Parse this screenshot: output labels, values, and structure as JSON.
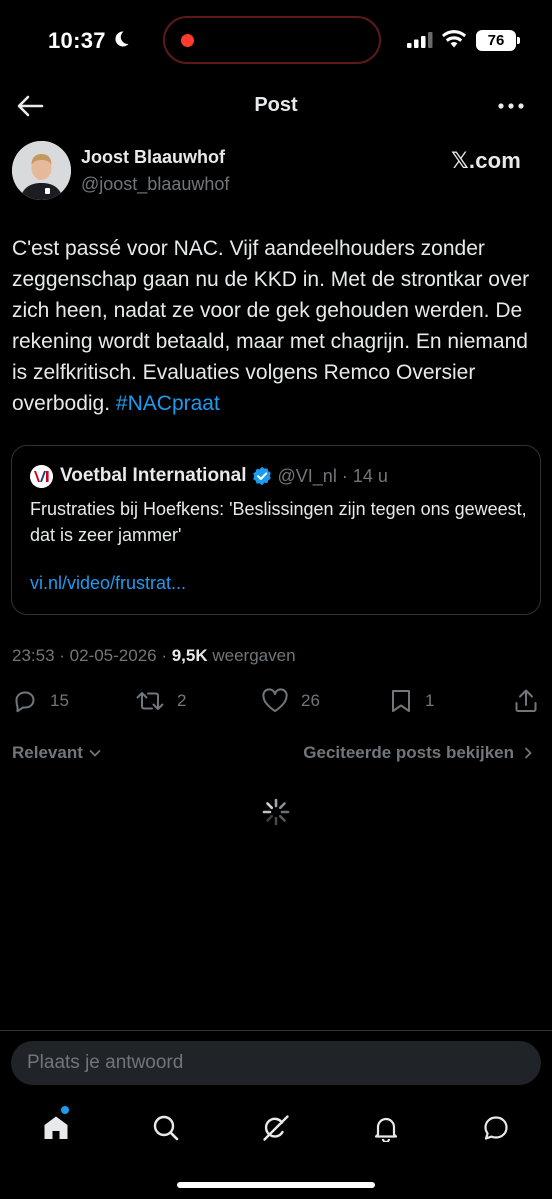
{
  "status_bar": {
    "time": "10:37",
    "battery": "76",
    "icons": [
      "moon-icon",
      "recording-dot",
      "signal-icon",
      "wifi-icon",
      "battery-icon"
    ]
  },
  "header": {
    "title": "Post",
    "back_icon": "arrow-left-icon",
    "more_icon": "more-horizontal-icon"
  },
  "author": {
    "name": "Joost Blaauwhof",
    "handle": "@joost_blaauwhof",
    "source": "𝕏.com"
  },
  "post": {
    "text": "C'est passé voor NAC. Vijf aandeelhouders zonder zeggenschap gaan nu de KKD in. Met de strontkar over zich heen, nadat ze voor de gek gehouden werden. De rekening wordt betaald, maar met chagrijn. En niemand is zelfkritisch. Evaluaties volgens Remco Oversier overbodig.",
    "hashtag": "#NACpraat"
  },
  "quote": {
    "name": "Voetbal International",
    "handle_time": "@VI_nl · 14 u",
    "text": "Frustraties bij Hoefkens: 'Beslissingen zijn tegen ons geweest, dat is zeer jammer'",
    "link": "vi.nl/video/frustrat..."
  },
  "meta": {
    "datetime": "23:53 · 02-05-2026 · ",
    "views_count": "9,5K",
    "views_label": " weergaven"
  },
  "actions": {
    "replies": "15",
    "reposts": "2",
    "likes": "26",
    "bookmarks": "1"
  },
  "filters": {
    "sort_label": "Relevant",
    "quotes_label": "Geciteerde posts bekijken"
  },
  "reply": {
    "placeholder": "Plaats je antwoord"
  },
  "nav": {
    "items": [
      "home-icon",
      "search-icon",
      "grok-icon",
      "notifications-icon",
      "messages-icon"
    ]
  },
  "colors": {
    "background": "#000000",
    "text": "#e7e9ea",
    "muted": "#71767b",
    "accent": "#1d9bf0",
    "border": "#2f3336"
  }
}
